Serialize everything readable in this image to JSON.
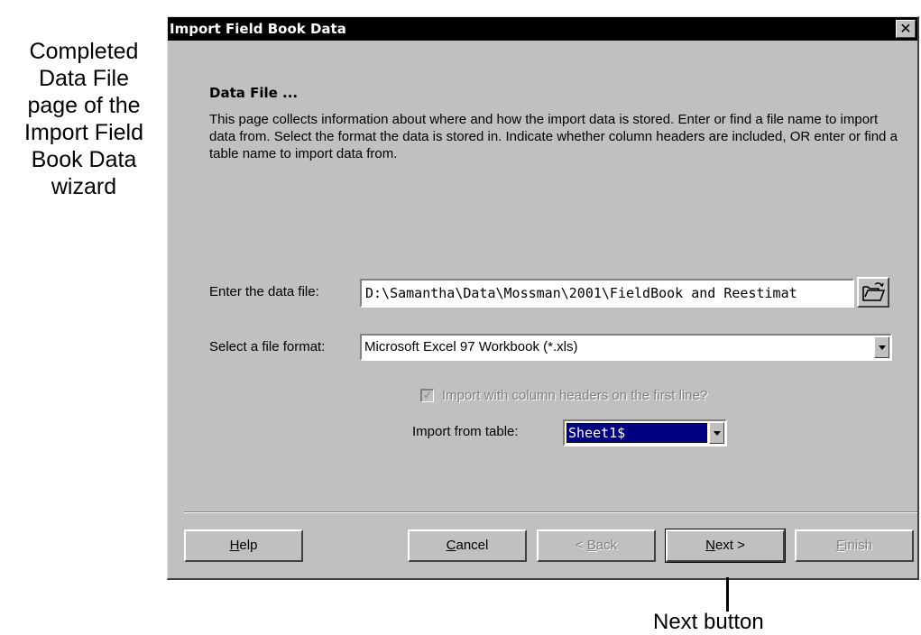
{
  "caption": {
    "lines": [
      "Completed",
      "Data File",
      "page of the",
      "Import Field",
      "Book Data",
      "wizard"
    ]
  },
  "dialog": {
    "title": "Import Field Book Data",
    "close_glyph": "✕",
    "section_title": "Data File ...",
    "description": "This page collects information about where and how the import data is stored.  Enter or find a file name to import data from.  Select the format the data is stored in.  Indicate whether column headers are included, OR enter or find a table name to import data from."
  },
  "data_file": {
    "label": "Enter the data file:",
    "value": "D:\\Samantha\\Data\\Mossman\\2001\\FieldBook and Reestimat"
  },
  "file_format": {
    "label": "Select a file format:",
    "value": "Microsoft Excel 97 Workbook (*.xls)"
  },
  "headers_checkbox": {
    "label": "Import with column headers on the first line?",
    "checked": true,
    "enabled": false
  },
  "import_table": {
    "label": "Import from table:",
    "value": "Sheet1$"
  },
  "buttons": {
    "help": {
      "mnemonic": "H",
      "rest": "elp"
    },
    "cancel": {
      "mnemonic": "C",
      "rest": "ancel"
    },
    "back": {
      "prefix": "< ",
      "mnemonic": "B",
      "rest": "ack"
    },
    "next": {
      "mnemonic": "N",
      "rest": "ext >"
    },
    "finish": {
      "mnemonic": "F",
      "rest": "inish"
    }
  },
  "annotation": {
    "label": "Next button"
  },
  "colors": {
    "titlebar": "#000000",
    "dialog_face": "#c0c0c0",
    "selection": "#000080"
  }
}
